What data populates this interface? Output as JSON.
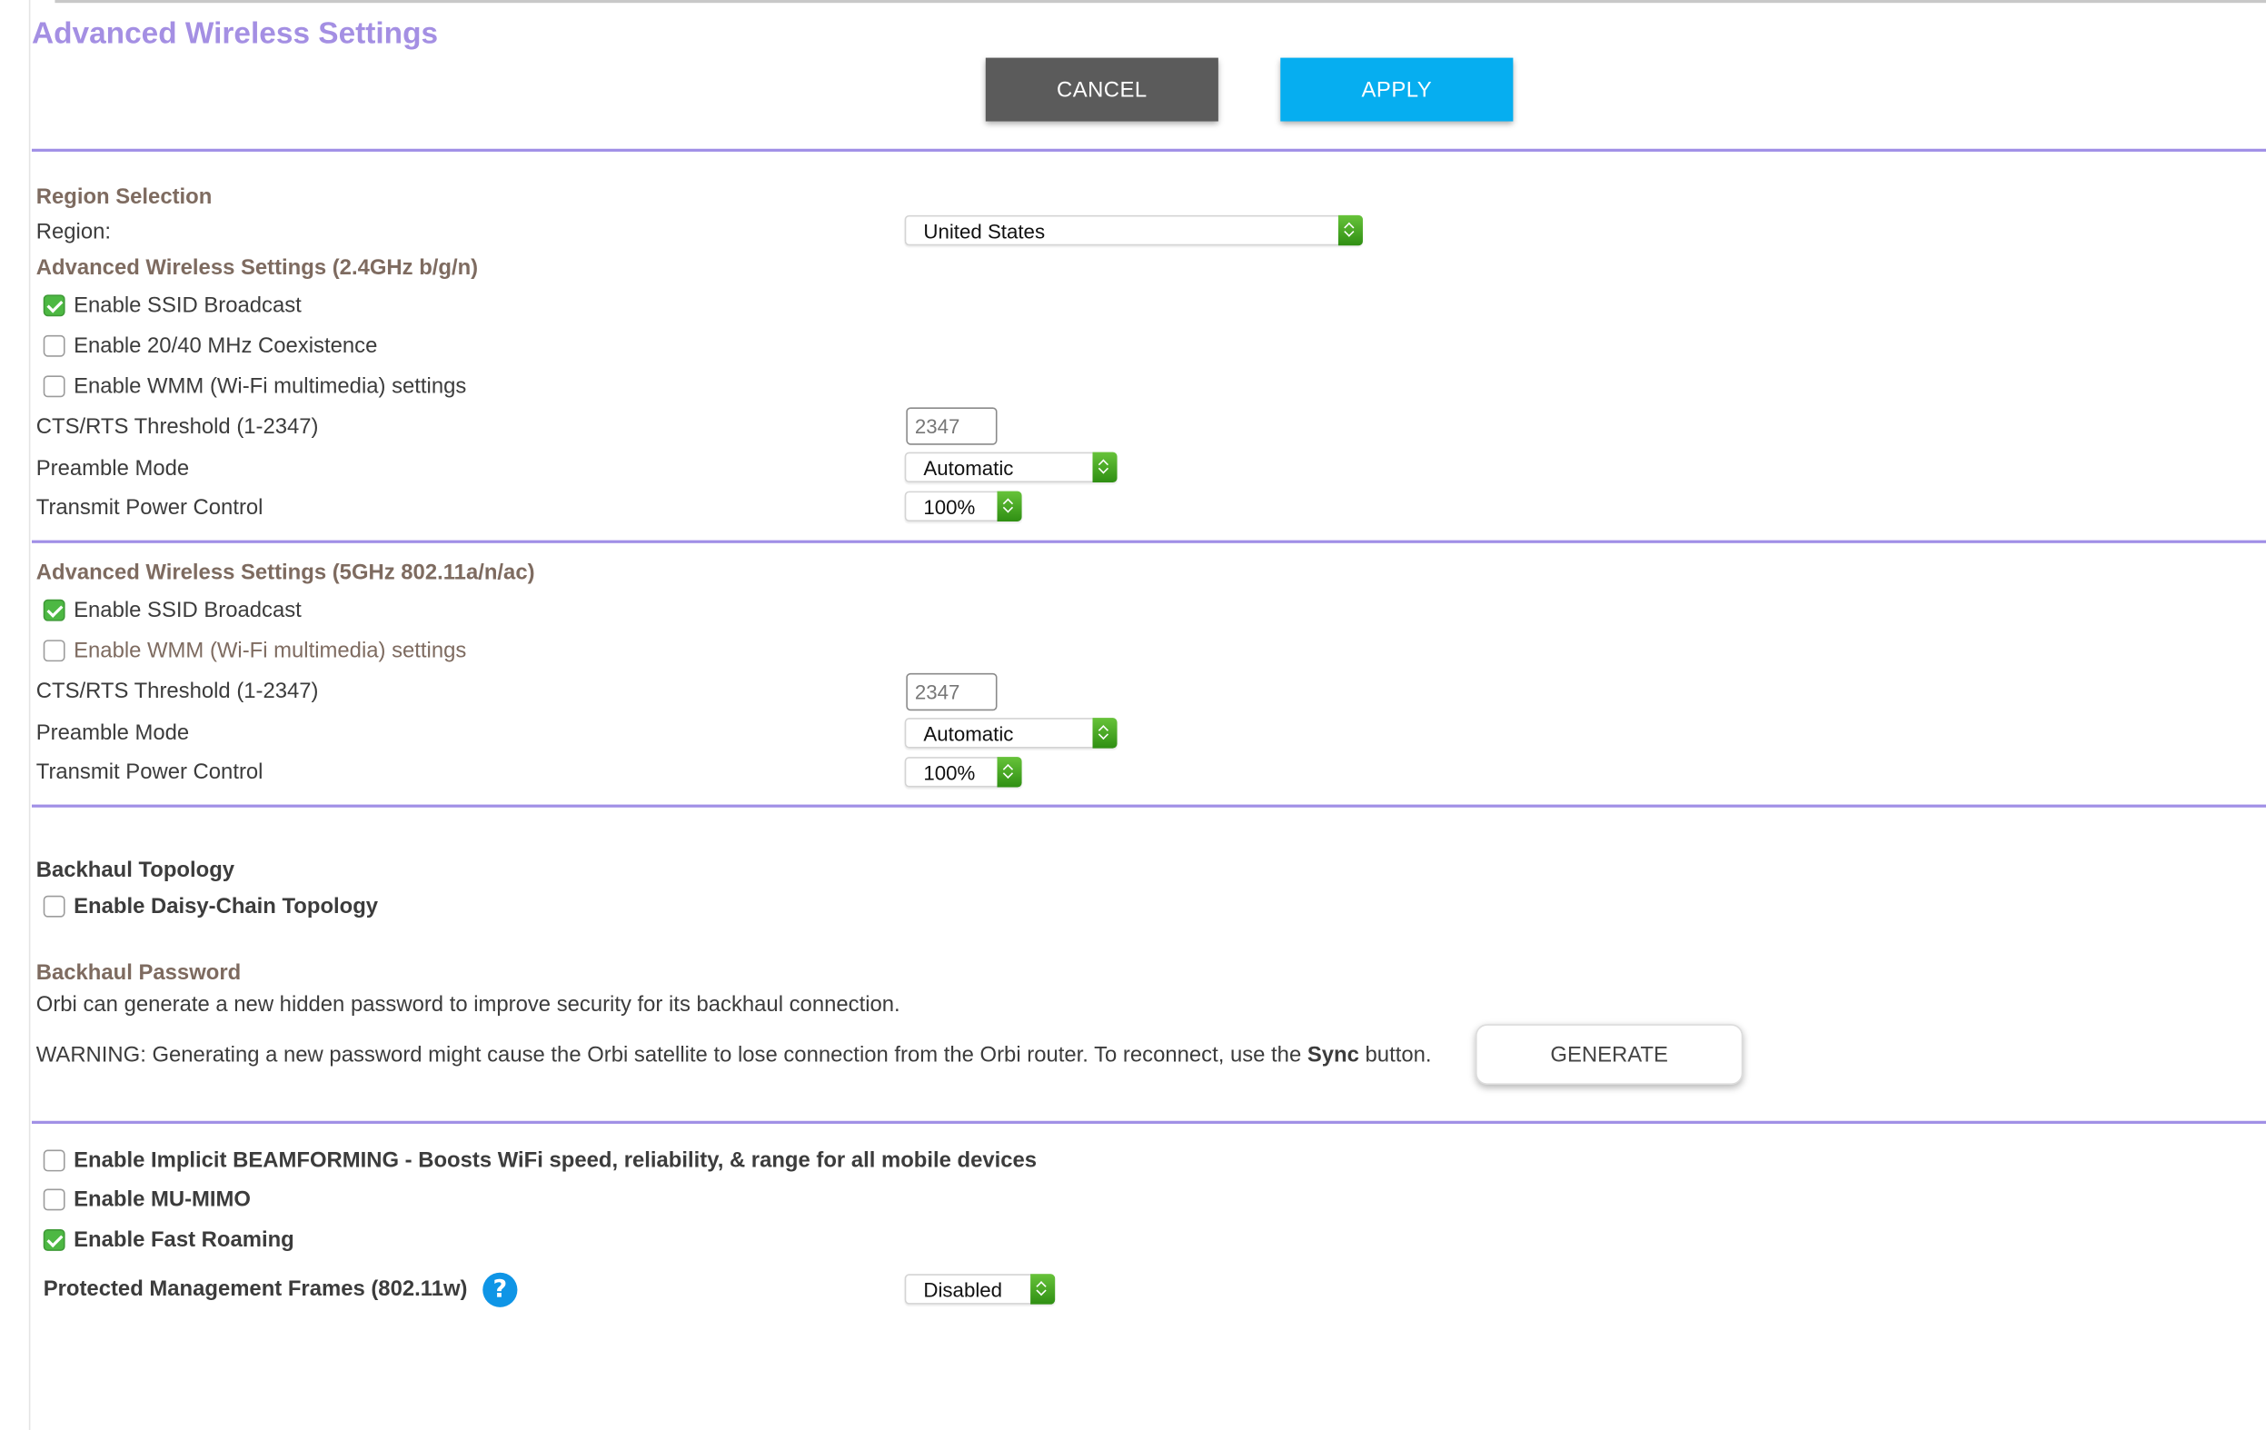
{
  "page": {
    "title": "Advanced Wireless Settings",
    "cancel_label": "CANCEL",
    "apply_label": "APPLY"
  },
  "region": {
    "heading": "Region Selection",
    "label": "Region:",
    "value": "United States"
  },
  "band_24": {
    "heading": "Advanced Wireless Settings (2.4GHz b/g/n)",
    "options": [
      {
        "label": "Enable SSID Broadcast",
        "checked": true
      },
      {
        "label": "Enable 20/40 MHz Coexistence",
        "checked": false
      },
      {
        "label": "Enable WMM (Wi-Fi multimedia) settings",
        "checked": false
      }
    ],
    "cts_label": "CTS/RTS Threshold (1-2347)",
    "cts_value": "2347",
    "preamble_label": "Preamble Mode",
    "preamble_value": "Automatic",
    "power_label": "Transmit Power Control",
    "power_value": "100%"
  },
  "band_5": {
    "heading": "Advanced Wireless Settings (5GHz 802.11a/n/ac)",
    "options": [
      {
        "label": "Enable SSID Broadcast",
        "checked": true
      },
      {
        "label": "Enable WMM (Wi-Fi multimedia) settings",
        "checked": false
      }
    ],
    "cts_label": "CTS/RTS Threshold (1-2347)",
    "cts_value": "2347",
    "preamble_label": "Preamble Mode",
    "preamble_value": "Automatic",
    "power_label": "Transmit Power Control",
    "power_value": "100%"
  },
  "backhaul": {
    "topology_heading": "Backhaul Topology",
    "daisy_chain_label": "Enable Daisy-Chain Topology",
    "daisy_chain_checked": false,
    "password_heading": "Backhaul Password",
    "password_description": "Orbi can generate a new hidden password to improve security for its backhaul connection.",
    "warning_prefix": "WARNING: Generating a new password might cause the Orbi satellite to lose connection from the Orbi router. To reconnect, use the ",
    "warning_bold": "Sync",
    "warning_suffix": " button.",
    "generate_label": "GENERATE"
  },
  "advanced": {
    "options": [
      {
        "label": "Enable Implicit BEAMFORMING - Boosts WiFi speed, reliability, & range for all mobile devices",
        "checked": false
      },
      {
        "label": "Enable MU-MIMO",
        "checked": false
      },
      {
        "label": "Enable Fast Roaming",
        "checked": true
      }
    ],
    "pmf_label": "Protected Management Frames (802.11w)",
    "pmf_help_icon": "?",
    "pmf_value": "Disabled"
  },
  "colors": {
    "title_purple": "#a48fe3",
    "divider_purple": "#a08fe6",
    "heading_brown": "#7e6b60",
    "apply_blue": "#06aef0",
    "cancel_gray": "#5b5b5b",
    "check_green": "#4db843",
    "help_blue": "#0f95e6"
  }
}
